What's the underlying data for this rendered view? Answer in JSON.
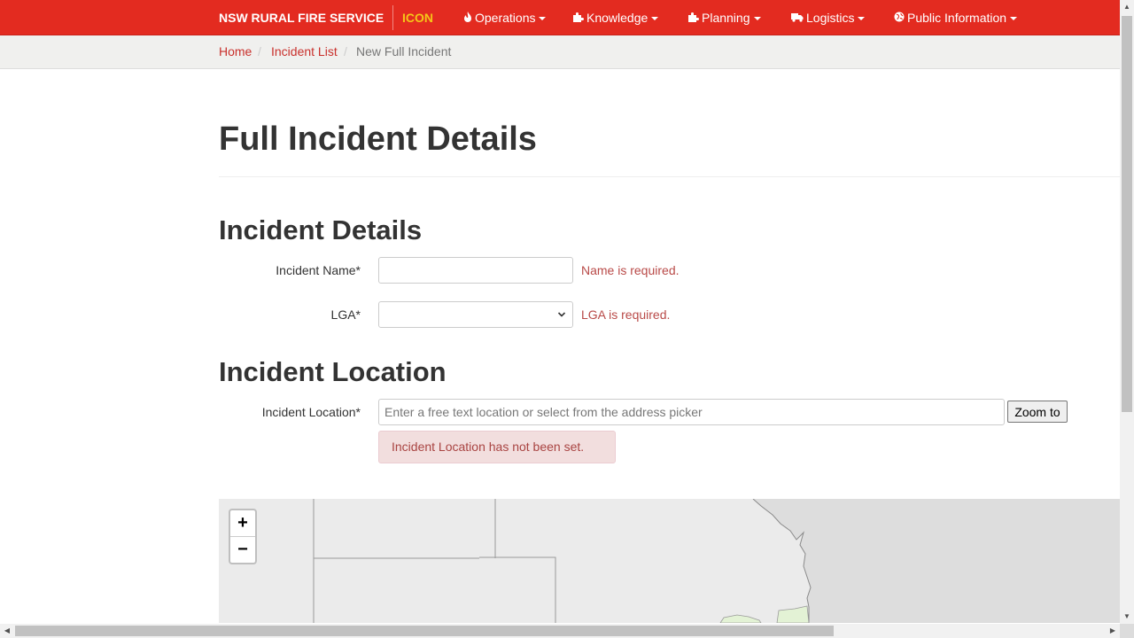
{
  "navbar": {
    "brand": "NSW RURAL FIRE SERVICE",
    "sub_brand": "ICON",
    "items": [
      {
        "label": "Operations",
        "icon": "fire-icon"
      },
      {
        "label": "Knowledge",
        "icon": "puzzle-icon"
      },
      {
        "label": "Planning",
        "icon": "puzzle-icon"
      },
      {
        "label": "Logistics",
        "icon": "truck-icon"
      },
      {
        "label": "Public Information",
        "icon": "globe-icon"
      }
    ]
  },
  "breadcrumb": {
    "items": [
      "Home",
      "Incident List",
      "New Full Incident"
    ],
    "separator": "/"
  },
  "page": {
    "title": "Full Incident Details"
  },
  "incident_details": {
    "heading": "Incident Details",
    "name_label": "Incident Name*",
    "name_value": "",
    "name_error": "Name is required.",
    "lga_label": "LGA*",
    "lga_value": "",
    "lga_error": "LGA is required."
  },
  "incident_location": {
    "heading": "Incident Location",
    "location_label": "Incident Location*",
    "location_placeholder": "Enter a free text location or select from the address picker",
    "location_value": "",
    "zoom_button": "Zoom to",
    "alert": "Incident Location has not been set."
  },
  "map": {
    "zoom_in": "+",
    "zoom_out": "−"
  },
  "colors": {
    "navbar": "#e32b20",
    "sub_brand": "#f5c518",
    "link": "#c9302c",
    "error": "#b94a48",
    "alert_bg": "#f2dede"
  }
}
